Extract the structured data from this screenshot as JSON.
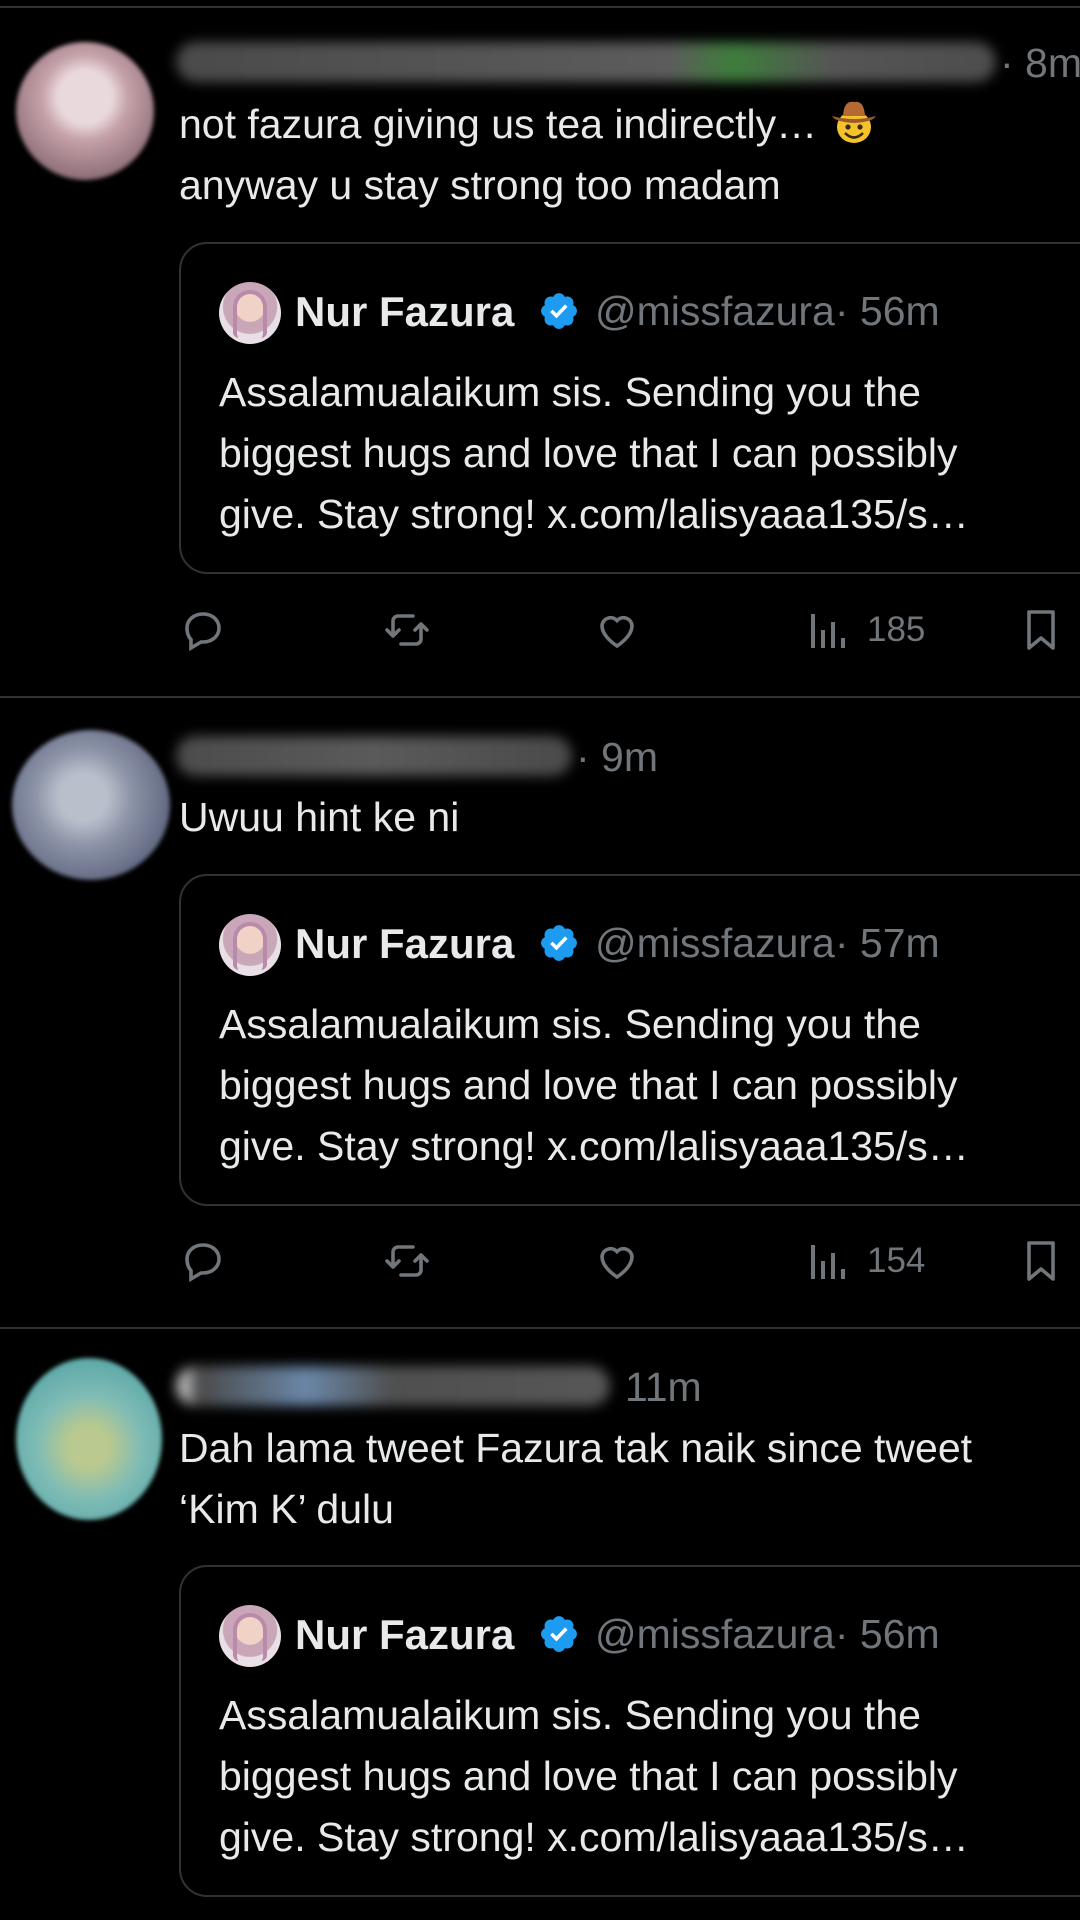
{
  "colors": {
    "background": "#000000",
    "text": "#e7e9ea",
    "muted": "#71767b",
    "divider": "#2f3336",
    "verified": "#1d9bf0"
  },
  "quoted_author": {
    "name": "Nur Fazura",
    "handle": "@missfazura",
    "verified_icon": "verified-badge-icon"
  },
  "posts": [
    {
      "time": "· 8m",
      "text_lines": [
        "not fazura giving us tea indirectly…",
        "anyway u stay strong too madam"
      ],
      "emoji": "cowboy-hat-face-emoji",
      "quote": {
        "time": "· 56m",
        "lines": [
          "Assalamualaikum sis. Sending you the",
          "biggest hugs and love that I can possibly",
          "give. Stay strong! x.com/lalisyaaa135/s…"
        ]
      },
      "views": "185"
    },
    {
      "time": "· 9m",
      "text_lines": [
        "Uwuu hint ke ni"
      ],
      "quote": {
        "time": "· 57m",
        "lines": [
          "Assalamualaikum sis. Sending you the",
          "biggest hugs and love that I can possibly",
          "give. Stay strong! x.com/lalisyaaa135/s…"
        ]
      },
      "views": "154"
    },
    {
      "time": "11m",
      "text_lines": [
        "Dah lama tweet Fazura tak naik since tweet",
        "‘Kim K’ dulu"
      ],
      "quote": {
        "time": "· 56m",
        "lines": [
          "Assalamualaikum sis. Sending you the",
          "biggest hugs and love that I can possibly",
          "give. Stay strong! x.com/lalisyaaa135/s…"
        ]
      }
    }
  ],
  "action_icons": [
    "reply-icon",
    "repost-icon",
    "like-icon",
    "views-icon",
    "bookmark-icon"
  ]
}
